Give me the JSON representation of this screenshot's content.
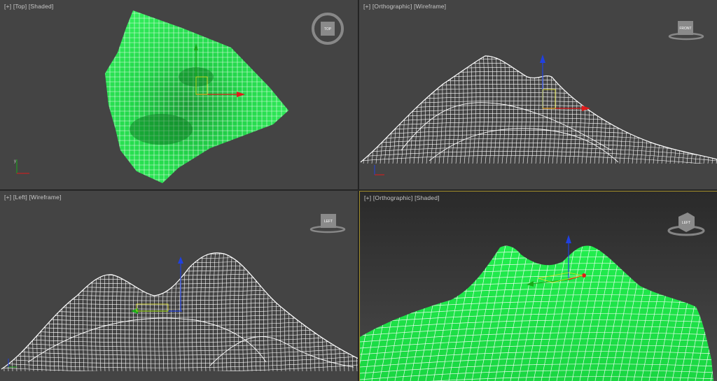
{
  "viewports": {
    "top": {
      "menu": "[+]",
      "view": "[Top]",
      "shading": "[Shaded]",
      "viewcube_label": "TOP"
    },
    "front": {
      "menu": "[+]",
      "view": "[Orthographic]",
      "shading": "[Wireframe]",
      "viewcube_label": "FRONT"
    },
    "left": {
      "menu": "[+]",
      "view": "[Left]",
      "shading": "[Wireframe]",
      "viewcube_label": "LEFT"
    },
    "perspective": {
      "menu": "[+]",
      "view": "[Orthographic]",
      "shading": "[Shaded]",
      "viewcube_label": "LEFT"
    }
  },
  "colors": {
    "viewport_bg": "#444444",
    "mesh_green": "#22e84a",
    "wire_white": "#ffffff",
    "active_border": "#a08c2a",
    "axis_x": "#e01a1a",
    "axis_y": "#1aaa1a",
    "axis_z": "#2040e0"
  },
  "gizmo_axes": {
    "x": "x",
    "y": "y",
    "z": "z"
  }
}
